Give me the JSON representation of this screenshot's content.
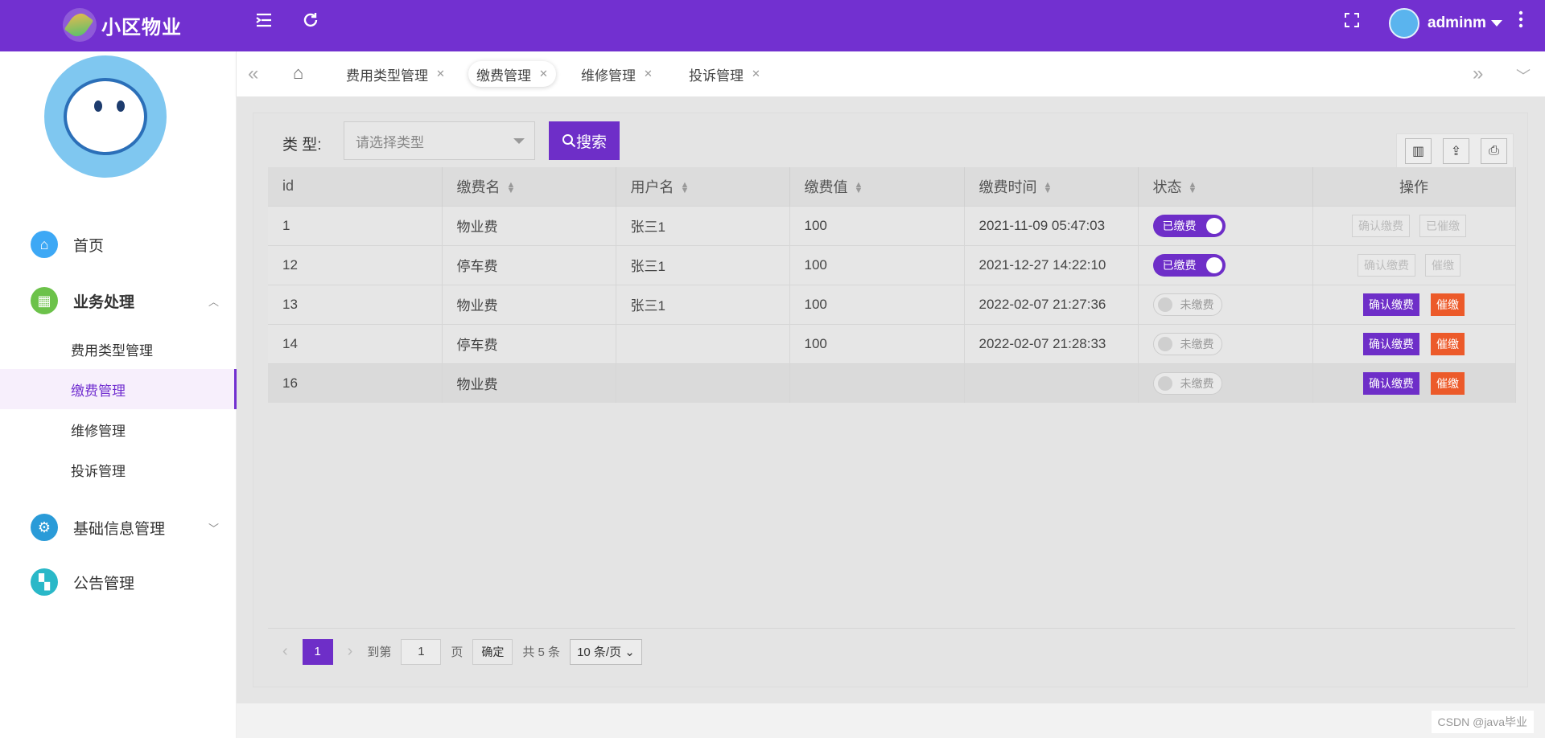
{
  "header": {
    "app_name": "小区物业",
    "user_name": "adminm"
  },
  "sidebar": {
    "items": [
      {
        "label": "首页",
        "icon": "home-icon",
        "color": "#3da8f5"
      },
      {
        "label": "业务处理",
        "icon": "business-icon",
        "color": "#6cc24a",
        "expanded": true
      },
      {
        "label": "基础信息管理",
        "icon": "gear-icon",
        "color": "#2a9bd8",
        "expanded": false
      },
      {
        "label": "公告管理",
        "icon": "apps-icon",
        "color": "#2ab8c8"
      }
    ],
    "sub_items": [
      "费用类型管理",
      "缴费管理",
      "维修管理",
      "投诉管理"
    ],
    "active_sub": "缴费管理"
  },
  "tabs": [
    {
      "label": "费用类型管理"
    },
    {
      "label": "缴费管理",
      "active": true
    },
    {
      "label": "维修管理"
    },
    {
      "label": "投诉管理"
    }
  ],
  "filter": {
    "label": "类 型:",
    "select_placeholder": "请选择类型",
    "search_label": "搜索"
  },
  "table": {
    "columns": [
      "id",
      "缴费名",
      "用户名",
      "缴费值",
      "缴费时间",
      "状态",
      "操作"
    ],
    "rows": [
      {
        "id": "1",
        "name": "物业费",
        "user": "张三1",
        "value": "100",
        "time": "2021-11-09 05:47:03",
        "status": "已缴费",
        "paid": true,
        "op1": "确认缴费",
        "op2": "已催缴"
      },
      {
        "id": "12",
        "name": "停车费",
        "user": "张三1",
        "value": "100",
        "time": "2021-12-27 14:22:10",
        "status": "已缴费",
        "paid": true,
        "op1": "确认缴费",
        "op2": "催缴"
      },
      {
        "id": "13",
        "name": "物业费",
        "user": "张三1",
        "value": "100",
        "time": "2022-02-07 21:27:36",
        "status": "未缴费",
        "paid": false,
        "op1": "确认缴费",
        "op2": "催缴"
      },
      {
        "id": "14",
        "name": "停车费",
        "user": "",
        "value": "100",
        "time": "2022-02-07 21:28:33",
        "status": "未缴费",
        "paid": false,
        "op1": "确认缴费",
        "op2": "催缴"
      },
      {
        "id": "16",
        "name": "物业费",
        "user": "",
        "value": "",
        "time": "",
        "status": "未缴费",
        "paid": false,
        "op1": "确认缴费",
        "op2": "催缴"
      }
    ]
  },
  "pager": {
    "current_page": "1",
    "goto_label": "到第",
    "goto_value": "1",
    "page_label": "页",
    "confirm_label": "确定",
    "total_label": "共 5 条",
    "page_size": "10 条/页"
  },
  "watermark": "CSDN @java毕业"
}
